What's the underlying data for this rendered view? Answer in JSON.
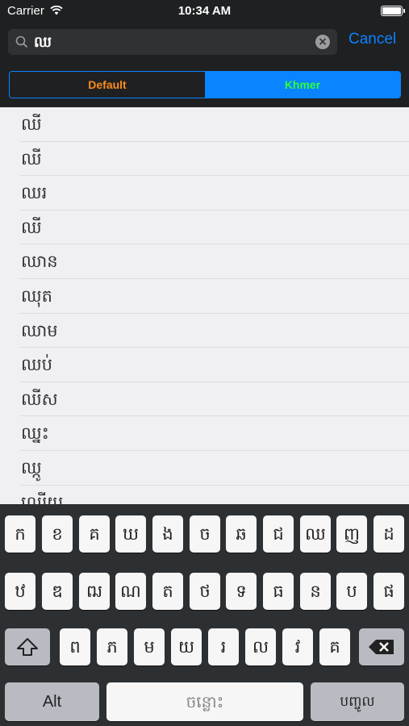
{
  "status": {
    "carrier": "Carrier",
    "time": "10:34 AM"
  },
  "search": {
    "query": "ឈ",
    "cancel_label": "Cancel"
  },
  "segments": {
    "default_label": "Default",
    "khmer_label": "Khmer",
    "selected": "Khmer"
  },
  "results": [
    "ឈី",
    "ឈី",
    "ឈរ",
    "ឈី",
    "ឈាន",
    "ឈុត",
    "ឈាម",
    "ឈប់",
    "ឈីស",
    "ឈ្នះ",
    "ឈ្កូ",
    "ឈ្លើយ"
  ],
  "keyboard": {
    "row1": [
      "ក",
      "ខ",
      "គ",
      "ឃ",
      "ង",
      "ច",
      "ឆ",
      "ជ",
      "ឈ",
      "ញ",
      "ដ"
    ],
    "row2": [
      "ឋ",
      "ឌ",
      "ឍ",
      "ណ",
      "ត",
      "ថ",
      "ទ",
      "ធ",
      "ន",
      "ប",
      "ផ"
    ],
    "row3": [
      "ព",
      "ភ",
      "ម",
      "យ",
      "រ",
      "ល",
      "វ",
      "គ"
    ],
    "alt_label": "Alt",
    "space_label": "ចន្លោះ",
    "return_label": "បញ្ចូល",
    "shift_icon": "shift-arrow-icon",
    "delete_icon": "backspace-icon"
  },
  "colors": {
    "accent": "#0a84ff",
    "default_text": "#ff8c1a",
    "khmer_text": "#2cff3a"
  }
}
